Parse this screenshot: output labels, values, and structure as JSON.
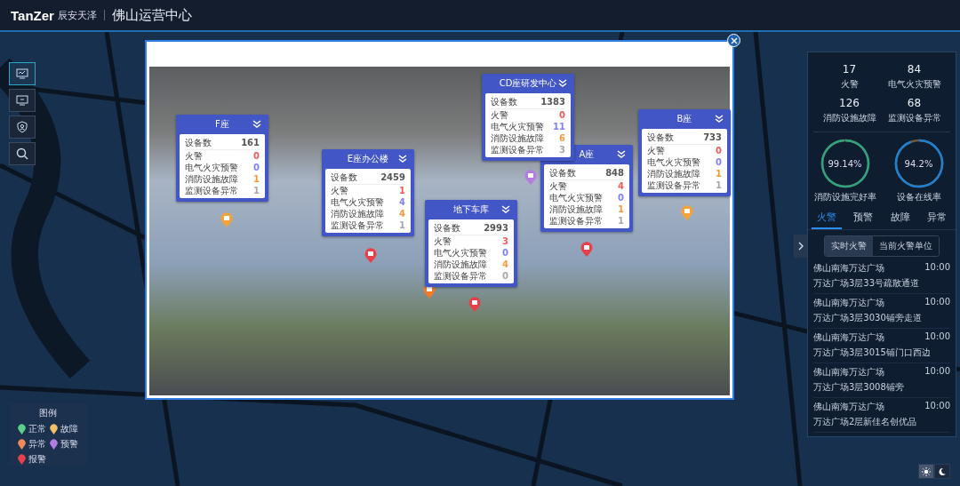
{
  "header": {
    "brand": "TanZer",
    "brand_cn": "辰安天泽",
    "title": "佛山运营中心"
  },
  "toolbar": [
    {
      "selected": true
    },
    {
      "selected": false
    },
    {
      "selected": false
    },
    {
      "selected": false
    }
  ],
  "cards": [
    {
      "title": "F座",
      "rows": [
        {
          "label": "设备数",
          "value": "161"
        },
        {
          "label": "火警",
          "value": "0",
          "color": "#f25a5a"
        },
        {
          "label": "电气火灾预警",
          "value": "0",
          "color": "#8080ff"
        },
        {
          "label": "消防设施故障",
          "value": "1",
          "color": "#f59a3c"
        },
        {
          "label": "监测设备异常",
          "value": "1",
          "color": "#a8a8a8"
        }
      ]
    },
    {
      "title": "E座办公楼",
      "rows": [
        {
          "label": "设备数",
          "value": "2459"
        },
        {
          "label": "火警",
          "value": "1",
          "color": "#f25a5a"
        },
        {
          "label": "电气火灾预警",
          "value": "4",
          "color": "#8080ff"
        },
        {
          "label": "消防设施故障",
          "value": "4",
          "color": "#f59a3c"
        },
        {
          "label": "监测设备异常",
          "value": "1",
          "color": "#a8a8a8"
        }
      ]
    },
    {
      "title": "CD座研发中心",
      "rows": [
        {
          "label": "设备数",
          "value": "1383"
        },
        {
          "label": "火警",
          "value": "0",
          "color": "#f25a5a"
        },
        {
          "label": "电气火灾预警",
          "value": "11",
          "color": "#8080ff"
        },
        {
          "label": "消防设施故障",
          "value": "6",
          "color": "#f59a3c"
        },
        {
          "label": "监测设备异常",
          "value": "3",
          "color": "#a8a8a8"
        }
      ]
    },
    {
      "title": "A座",
      "rows": [
        {
          "label": "设备数",
          "value": "848"
        },
        {
          "label": "火警",
          "value": "4",
          "color": "#f25a5a"
        },
        {
          "label": "电气火灾预警",
          "value": "0",
          "color": "#8080ff"
        },
        {
          "label": "消防设施故障",
          "value": "1",
          "color": "#f59a3c"
        },
        {
          "label": "监测设备异常",
          "value": "1",
          "color": "#a8a8a8"
        }
      ]
    },
    {
      "title": "地下车库",
      "rows": [
        {
          "label": "设备数",
          "value": "2993"
        },
        {
          "label": "火警",
          "value": "3",
          "color": "#f25a5a"
        },
        {
          "label": "电气火灾预警",
          "value": "0",
          "color": "#8080ff"
        },
        {
          "label": "消防设施故障",
          "value": "4",
          "color": "#f59a3c"
        },
        {
          "label": "监测设备异常",
          "value": "0",
          "color": "#a8a8a8"
        }
      ]
    },
    {
      "title": "B座",
      "rows": [
        {
          "label": "设备数",
          "value": "733"
        },
        {
          "label": "火警",
          "value": "0",
          "color": "#f25a5a"
        },
        {
          "label": "电气火灾预警",
          "value": "0",
          "color": "#8080ff"
        },
        {
          "label": "消防设施故障",
          "value": "1",
          "color": "#f59a3c"
        },
        {
          "label": "监测设备异常",
          "value": "1",
          "color": "#a8a8a8"
        }
      ]
    }
  ],
  "markers": [
    {
      "color": "#f4a33a"
    },
    {
      "color": "#e8404a"
    },
    {
      "color": "#b57be0"
    },
    {
      "color": "#e8404a"
    },
    {
      "color": "#e8404a"
    },
    {
      "color": "#f4a33a"
    },
    {
      "color": "#f07a2a"
    }
  ],
  "stats": [
    {
      "value": "17",
      "label": "火警"
    },
    {
      "value": "84",
      "label": "电气火灾预警"
    },
    {
      "value": "126",
      "label": "消防设施故障"
    },
    {
      "value": "68",
      "label": "监测设备异常"
    }
  ],
  "rings": [
    {
      "reading": "99.14%",
      "label": "消防设施完好率",
      "level": 0.9914,
      "color": "#2fa37e"
    },
    {
      "reading": "94.2%",
      "label": "设备在线率",
      "level": 0.942,
      "color": "#1f7fd0"
    }
  ],
  "tabs": [
    {
      "label": "火警",
      "selected": true
    },
    {
      "label": "预警",
      "selected": false
    },
    {
      "label": "故障",
      "selected": false
    },
    {
      "label": "异常",
      "selected": false
    }
  ],
  "segments": [
    {
      "label": "实时火警",
      "selected": true
    },
    {
      "label": "当前火警单位",
      "selected": false
    }
  ],
  "alarms": [
    {
      "place": "佛山南海万达广场",
      "time": "10:00",
      "detail": "万达广场3层33号疏散通道"
    },
    {
      "place": "佛山南海万达广场",
      "time": "10:00",
      "detail": "万达广场3层3030铺旁走道"
    },
    {
      "place": "佛山南海万达广场",
      "time": "10:00",
      "detail": "万达广场3层3015铺门口西边"
    },
    {
      "place": "佛山南海万达广场",
      "time": "10:00",
      "detail": "万达广场3层3008铺旁"
    },
    {
      "place": "佛山南海万达广场",
      "time": "10:00",
      "detail": "万达广场2层新佳名创优品"
    }
  ],
  "legend": {
    "title": "图例",
    "items": [
      {
        "label": "正常",
        "color": "#5ccf8a"
      },
      {
        "label": "故障",
        "color": "#f5c060"
      },
      {
        "label": "异常",
        "color": "#f08a5a"
      },
      {
        "label": "预警",
        "color": "#b57be0"
      },
      {
        "label": "报警",
        "color": "#e8404a"
      }
    ]
  },
  "theme_toggle": [
    {
      "selected": true
    },
    {
      "selected": false
    }
  ]
}
